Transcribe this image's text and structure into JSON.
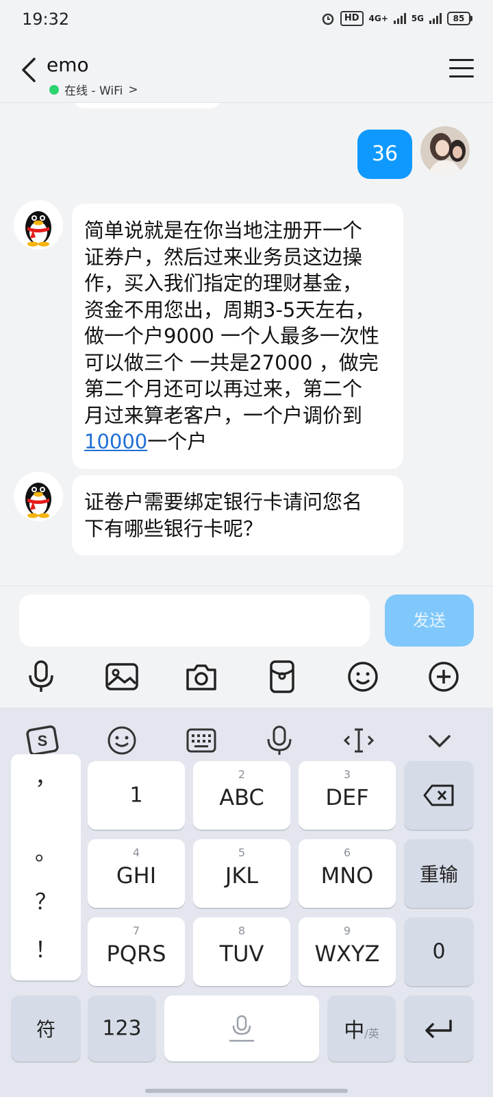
{
  "status_bar": {
    "time": "19:32",
    "hd": "HD",
    "net1": "4G+",
    "net2": "5G",
    "battery": "85"
  },
  "header": {
    "title": "emo",
    "status": "在线 - WiFi",
    "chevron": ">"
  },
  "messages": [
    {
      "side": "out",
      "text": "36"
    },
    {
      "side": "in",
      "lines": [
        "简单说就是在你当地注册开一个",
        "证券户，然后过来业务员这边操",
        "作，买入我们指定的理财基金，",
        "资金不用您出，周期3-5天左右，",
        "做一个户9000 一个人最多一次性",
        "可以做三个 一共是27000 ，做完",
        "第二个月还可以再过来，第二个",
        "月过来算老客户，一个户调价到"
      ],
      "link": "10000",
      "tail": "一个户"
    },
    {
      "side": "in",
      "lines": [
        "证卷户需要绑定银行卡请问您名",
        "下有哪些银行卡呢？"
      ]
    }
  ],
  "composer": {
    "send_label": "发送"
  },
  "toolbar_icons": [
    "microphone-icon",
    "image-icon",
    "camera-icon",
    "red-packet-icon",
    "emoji-icon",
    "plus-icon"
  ],
  "keyboard": {
    "top_icons": [
      "sogou-logo-icon",
      "emoji-icon",
      "keyboard-icon",
      "voice-icon",
      "cursor-icon",
      "collapse-icon"
    ],
    "punctuation": [
      "，",
      "。",
      "？",
      "！"
    ],
    "keys": {
      "k1": {
        "main": "1"
      },
      "k2": {
        "sub": "2",
        "main": "ABC"
      },
      "k3": {
        "sub": "3",
        "main": "DEF"
      },
      "k4": {
        "sub": "4",
        "main": "GHI"
      },
      "k5": {
        "sub": "5",
        "main": "JKL"
      },
      "k6": {
        "sub": "6",
        "main": "MNO"
      },
      "k7": {
        "sub": "7",
        "main": "PQRS"
      },
      "k8": {
        "sub": "8",
        "main": "TUV"
      },
      "k9": {
        "sub": "9",
        "main": "WXYZ"
      },
      "reenter": "重输",
      "zero": "0",
      "symbols": "符",
      "num": "123",
      "lang_main": "中",
      "lang_sub": "/英"
    }
  },
  "colors": {
    "accent": "#0f99ff",
    "send_disabled": "#80c8fb",
    "online": "#2dd36f",
    "link": "#1f6fd6"
  }
}
